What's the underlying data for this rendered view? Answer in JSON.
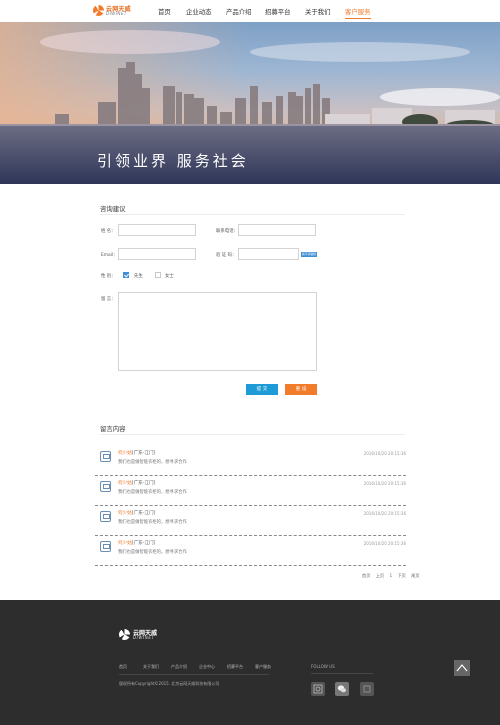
{
  "header": {
    "logo_cn": "云网天威",
    "logo_en": "DIWINET",
    "nav": [
      {
        "label": "首页"
      },
      {
        "label": "企业动态"
      },
      {
        "label": "产品介绍"
      },
      {
        "label": "招募平台"
      },
      {
        "label": "关于我们"
      },
      {
        "label": "客户服务"
      }
    ]
  },
  "banner": {
    "title": "引领业界 服务社会"
  },
  "consult": {
    "title": "咨询建议",
    "name_label": "姓    名：",
    "contact_label": "联系电话：",
    "email_label": "Email：",
    "verify_label": "验  证  码：",
    "verify_img_text": "看不清楚换一张",
    "gender_label": "性    别：",
    "gender_options": [
      "先生",
      "女士"
    ],
    "gender_selected": "先生",
    "message_label": "留    言：",
    "submit_label": "提 交",
    "reset_label": "重 设"
  },
  "messages": {
    "title": "留言内容",
    "items": [
      {
        "name": "何少姑",
        "location": "[广东-江门]",
        "body": "我们也是做智能衣柜的，想寻求合作",
        "time": "2016/10/20 20:15:36"
      },
      {
        "name": "何少姑",
        "location": "[广东-江门]",
        "body": "我们也是做智能衣柜的，想寻求合作",
        "time": "2016/10/20 20:15:36"
      },
      {
        "name": "何少姑",
        "location": "[广东-江门]",
        "body": "我们也是做智能衣柜的，想寻求合作",
        "time": "2016/10/20 20:15:36"
      },
      {
        "name": "何少姑",
        "location": "[广东-江门]",
        "body": "我们也是做智能衣柜的，想寻求合作",
        "time": "2016/10/20 20:15:36"
      }
    ],
    "pager": [
      "首页",
      "上页",
      "1",
      "下页",
      "尾页"
    ]
  },
  "footer": {
    "logo_cn": "云网天威",
    "logo_en": "DIWINET",
    "nav": [
      "首页",
      "关于我们",
      "产品介绍",
      "企业中心",
      "招募平台",
      "客户服务"
    ],
    "copyright": "版权所有Copyright©2015. 北京云网天威科技有限公司",
    "follow_label": "FOLLOW US",
    "social_icons": [
      "weibo-icon",
      "wechat-icon",
      "qq-icon"
    ]
  },
  "colors": {
    "accent": "#f07c2c",
    "blue": "#3f8fd8",
    "footer_bg": "#2d2d2d"
  }
}
